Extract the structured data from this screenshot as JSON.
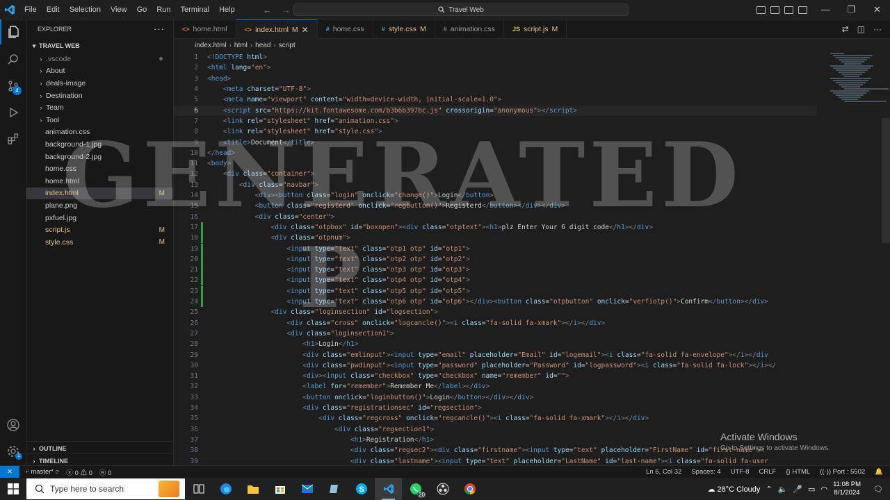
{
  "titlebar": {
    "menu": [
      "File",
      "Edit",
      "Selection",
      "View",
      "Go",
      "Run",
      "Terminal",
      "Help"
    ],
    "search": "Travel Web"
  },
  "sidebar": {
    "title": "EXPLORER",
    "folder": "TRAVEL WEB",
    "items": [
      {
        "label": ".vscode",
        "kind": "folder",
        "status": "dot"
      },
      {
        "label": "About",
        "kind": "folder",
        "status": ""
      },
      {
        "label": "deals-image",
        "kind": "folder",
        "status": ""
      },
      {
        "label": "Destination",
        "kind": "folder",
        "status": ""
      },
      {
        "label": "Team",
        "kind": "folder",
        "status": ""
      },
      {
        "label": "Tool",
        "kind": "folder",
        "status": ""
      },
      {
        "label": "animation.css",
        "kind": "file",
        "status": ""
      },
      {
        "label": "background-1.jpg",
        "kind": "file",
        "status": ""
      },
      {
        "label": "background-2.jpg",
        "kind": "file",
        "status": ""
      },
      {
        "label": "home.css",
        "kind": "file",
        "status": ""
      },
      {
        "label": "home.html",
        "kind": "file",
        "status": ""
      },
      {
        "label": "index.html",
        "kind": "file",
        "status": "M",
        "selected": true
      },
      {
        "label": "plane.png",
        "kind": "file",
        "status": ""
      },
      {
        "label": "pxfuel.jpg",
        "kind": "file",
        "status": ""
      },
      {
        "label": "script.js",
        "kind": "file",
        "status": "M"
      },
      {
        "label": "style.css",
        "kind": "file",
        "status": "M"
      }
    ],
    "outline": "OUTLINE",
    "timeline": "TIMELINE"
  },
  "tabs": [
    {
      "label": "home.html",
      "icon": "<>",
      "iconColor": "#e37933",
      "mod": "",
      "active": false
    },
    {
      "label": "index.html",
      "icon": "<>",
      "iconColor": "#e37933",
      "mod": "M",
      "active": true
    },
    {
      "label": "home.css",
      "icon": "#",
      "iconColor": "#519aba",
      "mod": "",
      "active": false
    },
    {
      "label": "style.css",
      "icon": "#",
      "iconColor": "#519aba",
      "mod": "M",
      "active": false
    },
    {
      "label": "animation.css",
      "icon": "#",
      "iconColor": "#519aba",
      "mod": "",
      "active": false
    },
    {
      "label": "script.js",
      "icon": "JS",
      "iconColor": "#cbcb41",
      "mod": "M",
      "active": false
    }
  ],
  "breadcrumb": [
    "index.html",
    "html",
    "head",
    "script"
  ],
  "code": [
    {
      "n": 1,
      "h": "<span class='p'>&lt;</span><span class='k'>!DOCTYPE</span> <span class='a'>html</span><span class='p'>&gt;</span>"
    },
    {
      "n": 2,
      "h": "<span class='p'>&lt;</span><span class='k'>html</span> <span class='a'>lang</span><span class='t'>=</span><span class='s'>\"en\"</span><span class='p'>&gt;</span>"
    },
    {
      "n": 3,
      "h": "<span class='p'>&lt;</span><span class='k'>head</span><span class='p'>&gt;</span>"
    },
    {
      "n": 4,
      "h": "    <span class='p'>&lt;</span><span class='k'>meta</span> <span class='a'>charset</span><span class='t'>=</span><span class='s'>\"UTF-8\"</span><span class='p'>&gt;</span>"
    },
    {
      "n": 5,
      "h": "    <span class='p'>&lt;</span><span class='k'>meta</span> <span class='a'>name</span><span class='t'>=</span><span class='s'>\"viewport\"</span> <span class='a'>content</span><span class='t'>=</span><span class='s'>\"width=device-width, initial-scale=1.0\"</span><span class='p'>&gt;</span>"
    },
    {
      "n": 6,
      "cur": true,
      "h": "    <span class='p'>&lt;</span><span class='k'>script</span> <span class='a'>src</span><span class='t'>=</span><span class='s'>\"https://kit.fontawesome.com/b3b6b397bc.js\"</span> <span class='a'>crossorigin</span><span class='t'>=</span><span class='s'>\"anonymous\"</span><span class='p'>&gt;&lt;/</span><span class='k'>script</span><span class='p'>&gt;</span>"
    },
    {
      "n": 7,
      "h": "    <span class='p'>&lt;</span><span class='k'>link</span> <span class='a'>rel</span><span class='t'>=</span><span class='s'>\"stylesheet\"</span> <span class='a'>href</span><span class='t'>=</span><span class='s'>\"animation.css\"</span><span class='p'>&gt;</span>"
    },
    {
      "n": 8,
      "h": "    <span class='p'>&lt;</span><span class='k'>link</span> <span class='a'>rel</span><span class='t'>=</span><span class='s'>\"stylesheet\"</span> <span class='a'>href</span><span class='t'>=</span><span class='s'>\"style.css\"</span><span class='p'>&gt;</span>"
    },
    {
      "n": 9,
      "h": "    <span class='p'>&lt;</span><span class='k'>title</span><span class='p'>&gt;</span><span class='t'>Document</span><span class='p'>&lt;/</span><span class='k'>title</span><span class='p'>&gt;</span>"
    },
    {
      "n": 10,
      "h": "<span class='p'>&lt;/</span><span class='k'>head</span><span class='p'>&gt;</span>"
    },
    {
      "n": 11,
      "h": "<span class='p'>&lt;</span><span class='k'>body</span><span class='p'>&gt;</span>"
    },
    {
      "n": 12,
      "h": "    <span class='p'>&lt;</span><span class='k'>div</span> <span class='a'>class</span><span class='t'>=</span><span class='s'>\"container\"</span><span class='p'>&gt;</span>"
    },
    {
      "n": 13,
      "h": "        <span class='p'>&lt;</span><span class='k'>div</span> <span class='a'>class</span><span class='t'>=</span><span class='s'>\"navbar\"</span><span class='p'>&gt;</span>"
    },
    {
      "n": 14,
      "h": "            <span class='p'>&lt;</span><span class='k'>div</span><span class='p'>&gt;&lt;</span><span class='k'>button</span> <span class='a'>class</span><span class='t'>=</span><span class='s'>\"login\"</span> <span class='a'>onclick</span><span class='t'>=</span><span class='s'>\"change()\"</span><span class='p'>&gt;</span><span class='t'>Login</span><span class='p'>&lt;/</span><span class='k'>button</span><span class='p'>&gt;</span>"
    },
    {
      "n": 15,
      "h": "            <span class='p'>&lt;</span><span class='k'>button</span> <span class='a'>class</span><span class='t'>=</span><span class='s'>\"registerd\"</span> <span class='a'>onclick</span><span class='t'>=</span><span class='s'>\"regbutton()\"</span><span class='p'>&gt;</span><span class='t'>Registerd</span><span class='p'>&lt;/</span><span class='k'>button</span><span class='p'>&gt;&lt;/</span><span class='k'>div</span><span class='p'>&gt;&lt;/</span><span class='k'>div</span><span class='p'>&gt;</span>"
    },
    {
      "n": 16,
      "h": "            <span class='p'>&lt;</span><span class='k'>div</span> <span class='a'>class</span><span class='t'>=</span><span class='s'>\"center\"</span><span class='p'>&gt;</span>"
    },
    {
      "n": 17,
      "g": true,
      "h": "                <span class='p'>&lt;</span><span class='k'>div</span> <span class='a'>class</span><span class='t'>=</span><span class='s'>\"otpbox\"</span> <span class='a'>id</span><span class='t'>=</span><span class='s'>\"boxopen\"</span><span class='p'>&gt;&lt;</span><span class='k'>div</span> <span class='a'>class</span><span class='t'>=</span><span class='s'>\"otptext\"</span><span class='p'>&gt;&lt;</span><span class='k'>h1</span><span class='p'>&gt;</span><span class='t'>plz Enter Your 6 digit code</span><span class='p'>&lt;/</span><span class='k'>h1</span><span class='p'>&gt;&lt;/</span><span class='k'>div</span><span class='p'>&gt;</span>"
    },
    {
      "n": 18,
      "g": true,
      "h": "                <span class='p'>&lt;</span><span class='k'>div</span> <span class='a'>class</span><span class='t'>=</span><span class='s'>\"otpnum\"</span><span class='p'>&gt;</span>"
    },
    {
      "n": 19,
      "g": true,
      "h": "                    <span class='p'>&lt;</span><span class='k'>input</span> <span class='a'>type</span><span class='t'>=</span><span class='s'>\"text\"</span> <span class='a'>class</span><span class='t'>=</span><span class='s'>\"otp1 otp\"</span> <span class='a'>id</span><span class='t'>=</span><span class='s'>\"otp1\"</span><span class='p'>&gt;</span>"
    },
    {
      "n": 20,
      "g": true,
      "h": "                    <span class='p'>&lt;</span><span class='k'>input</span> <span class='a'>type</span><span class='t'>=</span><span class='s'>\"text\"</span> <span class='a'>class</span><span class='t'>=</span><span class='s'>\"otp2 otp\"</span> <span class='a'>id</span><span class='t'>=</span><span class='s'>\"otp2\"</span><span class='p'>&gt;</span>"
    },
    {
      "n": 21,
      "g": true,
      "h": "                    <span class='p'>&lt;</span><span class='k'>input</span> <span class='a'>type</span><span class='t'>=</span><span class='s'>\"text\"</span> <span class='a'>class</span><span class='t'>=</span><span class='s'>\"otp3 otp\"</span> <span class='a'>id</span><span class='t'>=</span><span class='s'>\"otp3\"</span><span class='p'>&gt;</span>"
    },
    {
      "n": 22,
      "g": true,
      "h": "                    <span class='p'>&lt;</span><span class='k'>input</span> <span class='a'>type</span><span class='t'>=</span><span class='s'>\"text\"</span> <span class='a'>class</span><span class='t'>=</span><span class='s'>\"otp4 otp\"</span> <span class='a'>id</span><span class='t'>=</span><span class='s'>\"otp4\"</span><span class='p'>&gt;</span>"
    },
    {
      "n": 23,
      "g": true,
      "h": "                    <span class='p'>&lt;</span><span class='k'>input</span> <span class='a'>type</span><span class='t'>=</span><span class='s'>\"text\"</span> <span class='a'>class</span><span class='t'>=</span><span class='s'>\"otp5 otp\"</span> <span class='a'>id</span><span class='t'>=</span><span class='s'>\"otp5\"</span><span class='p'>&gt;</span>"
    },
    {
      "n": 24,
      "g": true,
      "h": "                    <span class='p'>&lt;</span><span class='k'>input</span> <span class='a'>type</span><span class='t'>=</span><span class='s'>\"text\"</span> <span class='a'>class</span><span class='t'>=</span><span class='s'>\"otp6 otp\"</span> <span class='a'>id</span><span class='t'>=</span><span class='s'>\"otp6\"</span><span class='p'>&gt;&lt;/</span><span class='k'>div</span><span class='p'>&gt;&lt;</span><span class='k'>button</span> <span class='a'>class</span><span class='t'>=</span><span class='s'>\"otpbutton\"</span> <span class='a'>onclick</span><span class='t'>=</span><span class='s'>\"verfiotp()\"</span><span class='p'>&gt;</span><span class='t'>Confirm</span><span class='p'>&lt;/</span><span class='k'>button</span><span class='p'>&gt;&lt;/</span><span class='k'>div</span><span class='p'>&gt;</span>"
    },
    {
      "n": 25,
      "h": "                <span class='p'>&lt;</span><span class='k'>div</span> <span class='a'>class</span><span class='t'>=</span><span class='s'>\"loginsection\"</span> <span class='a'>id</span><span class='t'>=</span><span class='s'>\"logsection\"</span><span class='p'>&gt;</span>"
    },
    {
      "n": 26,
      "h": "                    <span class='p'>&lt;</span><span class='k'>div</span> <span class='a'>class</span><span class='t'>=</span><span class='s'>\"cross\"</span> <span class='a'>onclick</span><span class='t'>=</span><span class='s'>\"logcancle()\"</span><span class='p'>&gt;&lt;</span><span class='k'>i</span> <span class='a'>class</span><span class='t'>=</span><span class='s'>\"fa-solid fa-xmark\"</span><span class='p'>&gt;&lt;/</span><span class='k'>i</span><span class='p'>&gt;&lt;/</span><span class='k'>div</span><span class='p'>&gt;</span>"
    },
    {
      "n": 27,
      "h": "                    <span class='p'>&lt;</span><span class='k'>div</span> <span class='a'>class</span><span class='t'>=</span><span class='s'>\"loginsection1\"</span><span class='p'>&gt;</span>"
    },
    {
      "n": 28,
      "h": "                        <span class='p'>&lt;</span><span class='k'>h1</span><span class='p'>&gt;</span><span class='t'>Login</span><span class='p'>&lt;/</span><span class='k'>h1</span><span class='p'>&gt;</span>"
    },
    {
      "n": 29,
      "h": "                        <span class='p'>&lt;</span><span class='k'>div</span> <span class='a'>class</span><span class='t'>=</span><span class='s'>\"emlinput\"</span><span class='p'>&gt;&lt;</span><span class='k'>input</span> <span class='a'>type</span><span class='t'>=</span><span class='s'>\"email\"</span> <span class='a'>placeholder</span><span class='t'>=</span><span class='s'>\"Email\"</span> <span class='a'>id</span><span class='t'>=</span><span class='s'>\"logemail\"</span><span class='p'>&gt;&lt;</span><span class='k'>i</span> <span class='a'>class</span><span class='t'>=</span><span class='s'>\"fa-solid fa-envelope\"</span><span class='p'>&gt;&lt;/</span><span class='k'>i</span><span class='p'>&gt;&lt;/</span><span class='k'>div</span>"
    },
    {
      "n": 30,
      "h": "                        <span class='p'>&lt;</span><span class='k'>div</span> <span class='a'>class</span><span class='t'>=</span><span class='s'>\"pwdinput\"</span><span class='p'>&gt;&lt;</span><span class='k'>input</span> <span class='a'>type</span><span class='t'>=</span><span class='s'>\"password\"</span> <span class='a'>placeholder</span><span class='t'>=</span><span class='s'>\"Password\"</span> <span class='a'>id</span><span class='t'>=</span><span class='s'>\"logpassword\"</span><span class='p'>&gt;&lt;</span><span class='k'>i</span> <span class='a'>class</span><span class='t'>=</span><span class='s'>\"fa-solid fa-lock\"</span><span class='p'>&gt;&lt;/</span><span class='k'>i</span><span class='p'>&gt;&lt;/</span>"
    },
    {
      "n": 31,
      "h": "                        <span class='p'>&lt;</span><span class='k'>div</span><span class='p'>&gt;&lt;</span><span class='k'>input</span> <span class='a'>class</span><span class='t'>=</span><span class='s'>\"checkbox\"</span> <span class='a'>type</span><span class='t'>=</span><span class='s'>\"checkbox\"</span> <span class='a'>name</span><span class='t'>=</span><span class='s'>\"remember\"</span> <span class='a'>id</span><span class='t'>=</span><span class='s'>\"\"</span><span class='p'>&gt;</span>"
    },
    {
      "n": 32,
      "h": "                        <span class='p'>&lt;</span><span class='k'>label</span> <span class='a'>for</span><span class='t'>=</span><span class='s'>\"remember\"</span><span class='p'>&gt;</span><span class='t'>Remember Me</span><span class='p'>&lt;/</span><span class='k'>label</span><span class='p'>&gt;&lt;/</span><span class='k'>div</span><span class='p'>&gt;</span>"
    },
    {
      "n": 33,
      "h": "                        <span class='p'>&lt;</span><span class='k'>button</span> <span class='a'>onclick</span><span class='t'>=</span><span class='s'>\"loginbutton()\"</span><span class='p'>&gt;</span><span class='t'>Login</span><span class='p'>&lt;/</span><span class='k'>button</span><span class='p'>&gt;&lt;/</span><span class='k'>div</span><span class='p'>&gt;&lt;/</span><span class='k'>div</span><span class='p'>&gt;</span>"
    },
    {
      "n": 34,
      "h": "                        <span class='p'>&lt;</span><span class='k'>div</span> <span class='a'>class</span><span class='t'>=</span><span class='s'>\"registrationsec\"</span> <span class='a'>id</span><span class='t'>=</span><span class='s'>\"regsection\"</span><span class='p'>&gt;</span>"
    },
    {
      "n": 35,
      "h": "                            <span class='p'>&lt;</span><span class='k'>div</span> <span class='a'>class</span><span class='t'>=</span><span class='s'>\"regcross\"</span> <span class='a'>onclick</span><span class='t'>=</span><span class='s'>\"regcancle()\"</span><span class='p'>&gt;&lt;</span><span class='k'>i</span> <span class='a'>class</span><span class='t'>=</span><span class='s'>\"fa-solid fa-xmark\"</span><span class='p'>&gt;&lt;/</span><span class='k'>i</span><span class='p'>&gt;&lt;/</span><span class='k'>div</span><span class='p'>&gt;</span>"
    },
    {
      "n": 36,
      "h": "                                <span class='p'>&lt;</span><span class='k'>div</span> <span class='a'>class</span><span class='t'>=</span><span class='s'>\"regsection1\"</span><span class='p'>&gt;</span>"
    },
    {
      "n": 37,
      "h": "                                    <span class='p'>&lt;</span><span class='k'>h1</span><span class='p'>&gt;</span><span class='t'>Registration</span><span class='p'>&lt;/</span><span class='k'>h1</span><span class='p'>&gt;</span>"
    },
    {
      "n": 38,
      "h": "                                    <span class='p'>&lt;</span><span class='k'>div</span> <span class='a'>class</span><span class='t'>=</span><span class='s'>\"regsec2\"</span><span class='p'>&gt;&lt;</span><span class='k'>div</span> <span class='a'>class</span><span class='t'>=</span><span class='s'>\"firstname\"</span><span class='p'>&gt;&lt;</span><span class='k'>input</span> <span class='a'>type</span><span class='t'>=</span><span class='s'>\"text\"</span> <span class='a'>placeholder</span><span class='t'>=</span><span class='s'>\"FirstName\"</span> <span class='a'>id</span><span class='t'>=</span><span class='s'>\"first-name\"</span><span class='p'>&gt;&lt;</span>"
    },
    {
      "n": 39,
      "h": "                                    <span class='p'>&lt;</span><span class='k'>div</span> <span class='a'>class</span><span class='t'>=</span><span class='s'>\"lastname\"</span><span class='p'>&gt;&lt;</span><span class='k'>input</span> <span class='a'>type</span><span class='t'>=</span><span class='s'>\"text\"</span> <span class='a'>placeholder</span><span class='t'>=</span><span class='s'>\"LastName\"</span> <span class='a'>id</span><span class='t'>=</span><span class='s'>\"last-name\"</span><span class='p'>&gt;&lt;</span><span class='k'>i</span> <span class='a'>class</span><span class='t'>=</span><span class='s'>\"fa-solid fa-user</span>"
    }
  ],
  "watermark": {
    "line1": "GENERATED",
    "line2": "P"
  },
  "activation": {
    "title": "Activate Windows",
    "sub": "Go to Settings to activate Windows."
  },
  "status": {
    "branch": "master*",
    "problems": "ⓧ 0 ⚠ 0",
    "ports_fwd": "ⓦ 0",
    "position": "Ln 6, Col 32",
    "spaces": "Spaces: 4",
    "encoding": "UTF-8",
    "eol": "CRLF",
    "lang": "HTML",
    "port": "Port : 5502"
  },
  "taskbar": {
    "search": "Type here to search",
    "weather": "28°C  Cloudy",
    "time": "11:08 PM",
    "date": "8/1/2024",
    "wa_badge": "20"
  }
}
